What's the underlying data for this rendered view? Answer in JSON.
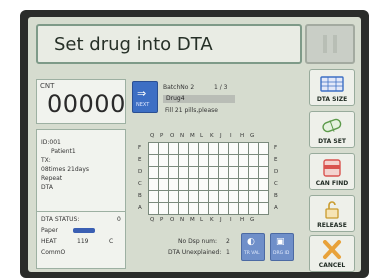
{
  "header": {
    "message": "Set drug into DTA"
  },
  "counter": {
    "label": "CNT",
    "value": "00000"
  },
  "patient_info": {
    "id": "ID:001",
    "name": "Patient1",
    "tx": "TX:",
    "duration": "08times  21days",
    "repeat": "Repeat",
    "dta": "DTA"
  },
  "dta_status": {
    "title": "DTA STATUS:",
    "title_value": "0",
    "paper_label": "Paper",
    "heat_label": "HEAT",
    "heat_value": "119",
    "heat_unit": "C",
    "comm_label": "CommO"
  },
  "next_button": {
    "glyph": "⇒",
    "label": "NEXT"
  },
  "batch": {
    "batch_no_label": "BatchNo 2",
    "count": "1 / 3",
    "drug": "Drug4",
    "fill": "Fill 21  pills,please"
  },
  "grid": {
    "col_letters": [
      "Q",
      "P",
      "O",
      "N",
      "M",
      "L",
      "K",
      "J",
      "I",
      "H",
      "G"
    ],
    "row_letters": [
      "F",
      "E",
      "D",
      "C",
      "B",
      "A"
    ]
  },
  "bottom_status": {
    "no_dsp": "No Dsp num:",
    "no_dsp_value": "2",
    "dta_unexplained": "DTA Unexplained:",
    "dta_unexplained_value": "1"
  },
  "small_buttons": [
    {
      "glyph": "◐",
      "label": "TR VAL"
    },
    {
      "glyph": "▣",
      "label": "DRG ID"
    }
  ],
  "right_buttons": [
    {
      "label": "DTA SIZE",
      "icon": "dta-size-icon"
    },
    {
      "label": "DTA SET",
      "icon": "dta-set-icon"
    },
    {
      "label": "CAN FIND",
      "icon": "can-find-icon"
    },
    {
      "label": "RELEASE",
      "icon": "release-icon"
    },
    {
      "label": "CANCEL",
      "icon": "cancel-icon"
    }
  ],
  "colors": {
    "accent_blue": "#3d6fc4",
    "cancel_orange": "#e8a23a",
    "can_red": "#d9534f"
  }
}
